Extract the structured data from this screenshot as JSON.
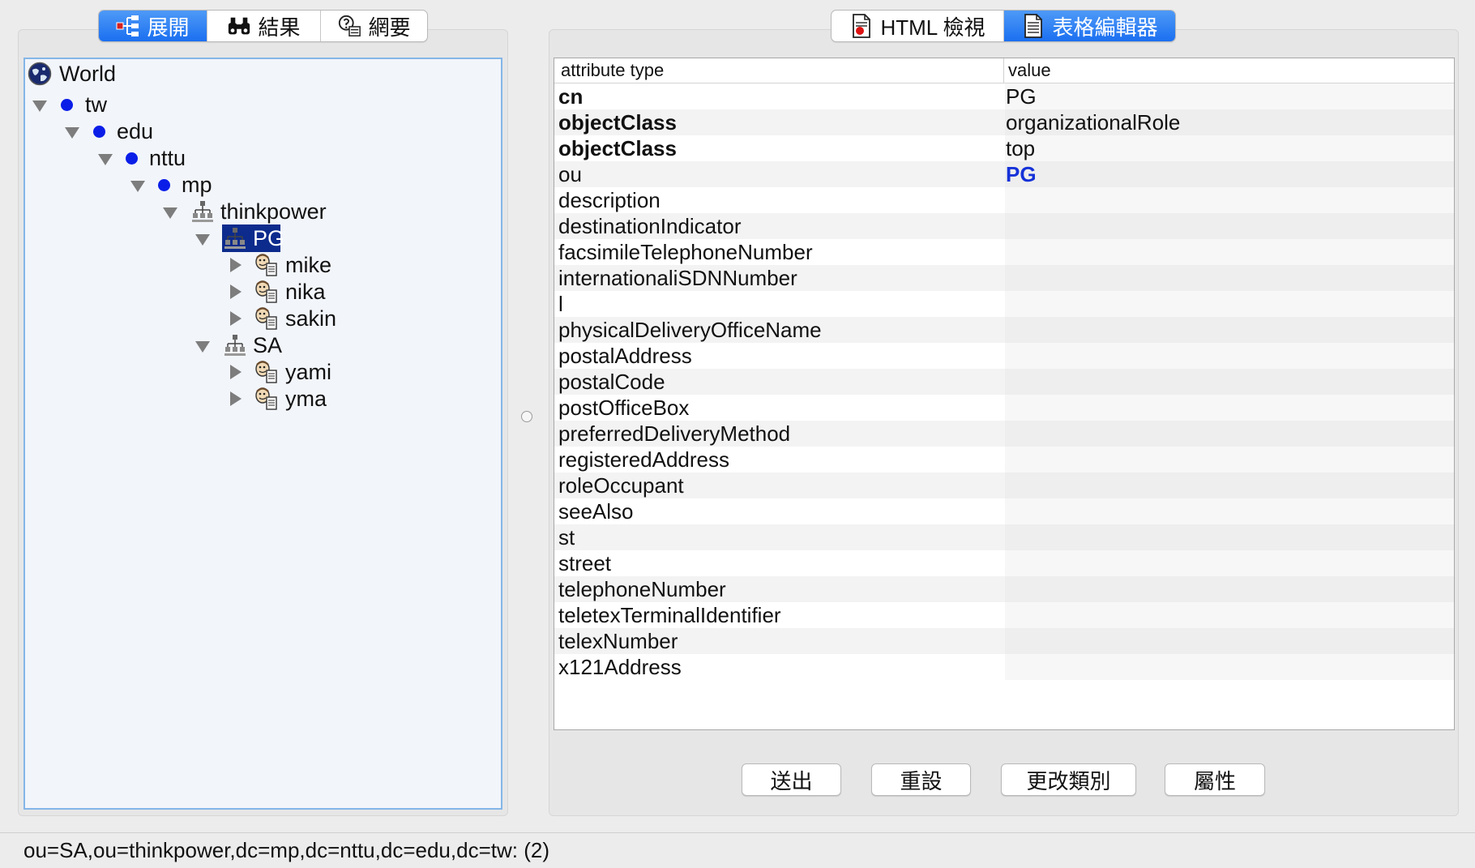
{
  "left_tabs": [
    {
      "label": "展開",
      "icon": "tree-expand-icon",
      "active": true
    },
    {
      "label": "結果",
      "icon": "binoculars-icon",
      "active": false
    },
    {
      "label": "網要",
      "icon": "schema-icon",
      "active": false
    }
  ],
  "right_tabs": [
    {
      "label": "HTML 檢視",
      "icon": "html-document-icon",
      "active": false
    },
    {
      "label": "表格編輯器",
      "icon": "table-document-icon",
      "active": true
    }
  ],
  "tree": {
    "root": "World",
    "nodes": {
      "tw": "tw",
      "edu": "edu",
      "nttu": "nttu",
      "mp": "mp",
      "thinkpower": "thinkpower",
      "pg": "PG",
      "mike": "mike",
      "nika": "nika",
      "sakin": "sakin",
      "sa": "SA",
      "yami": "yami",
      "yma": "yma"
    }
  },
  "table": {
    "headers": {
      "attr": "attribute type",
      "value": "value"
    },
    "rows": [
      {
        "attr": "cn",
        "value": "PG"
      },
      {
        "attr": "objectClass",
        "value": "organizationalRole"
      },
      {
        "attr": "objectClass",
        "value": "top"
      },
      {
        "attr": "ou",
        "value": "PG"
      },
      {
        "attr": "description",
        "value": ""
      },
      {
        "attr": "destinationIndicator",
        "value": ""
      },
      {
        "attr": "facsimileTelephoneNumber",
        "value": ""
      },
      {
        "attr": "internationaliSDNNumber",
        "value": ""
      },
      {
        "attr": "l",
        "value": ""
      },
      {
        "attr": "physicalDeliveryOfficeName",
        "value": ""
      },
      {
        "attr": "postalAddress",
        "value": ""
      },
      {
        "attr": "postalCode",
        "value": ""
      },
      {
        "attr": "postOfficeBox",
        "value": ""
      },
      {
        "attr": "preferredDeliveryMethod",
        "value": ""
      },
      {
        "attr": "registeredAddress",
        "value": ""
      },
      {
        "attr": "roleOccupant",
        "value": ""
      },
      {
        "attr": "seeAlso",
        "value": ""
      },
      {
        "attr": "st",
        "value": ""
      },
      {
        "attr": "street",
        "value": ""
      },
      {
        "attr": "telephoneNumber",
        "value": ""
      },
      {
        "attr": "teletexTerminalIdentifier",
        "value": ""
      },
      {
        "attr": "telexNumber",
        "value": ""
      },
      {
        "attr": "x121Address",
        "value": ""
      }
    ]
  },
  "buttons": {
    "submit": "送出",
    "reset": "重設",
    "change_class": "更改類別",
    "properties": "屬性"
  },
  "status": "ou=SA,ou=thinkpower,dc=mp,dc=nttu,dc=edu,dc=tw: (2)",
  "colors": {
    "accent": "#1b6ff0",
    "selection": "#0c2b8c",
    "dot": "#0a1ee8",
    "tree_border": "#84b6e8"
  }
}
